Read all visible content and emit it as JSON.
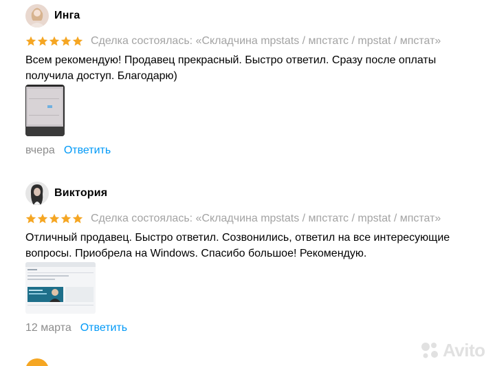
{
  "colors": {
    "star": "#f5a623",
    "link": "#0099f7",
    "muted": "#a3a3a3",
    "date": "#8c8c8c"
  },
  "reviews": [
    {
      "name": "Инга",
      "rating": 5,
      "deal": "Сделка состоялась: «Складчина mpstats / мпстатс / mpstat / мпстат»",
      "text": "Всем рекомендую! Продавец прекрасный. Быстро ответил. Сразу после оплаты получила доступ. Благодарю)",
      "date": "вчера",
      "reply_label": "Ответить"
    },
    {
      "name": "Виктория",
      "rating": 5,
      "deal": "Сделка состоялась: «Складчина mpstats / мпстатс / mpstat / мпстат»",
      "text": "Отличный продавец. Быстро ответил. Созвонились, ответил на все интересующие вопросы. Приобрела на Windows. Спасибо большое! Рекомендую.",
      "date": "12 марта",
      "reply_label": "Ответить"
    }
  ],
  "watermark": "Avito"
}
